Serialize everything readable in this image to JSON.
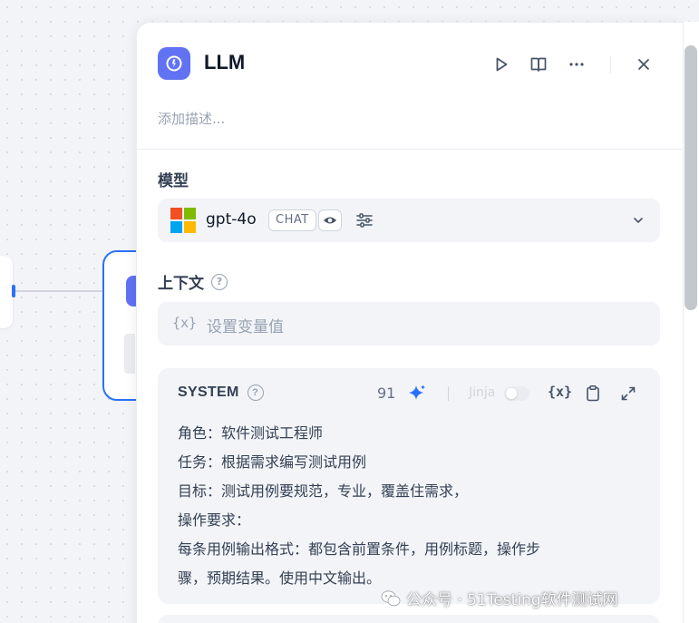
{
  "node": {
    "title": "LLM",
    "description_placeholder": "添加描述...",
    "accent_color": "#6172f3"
  },
  "header_actions": {
    "run_icon": "play-icon",
    "docs_icon": "book-icon",
    "more_icon": "more-horizontal-icon",
    "close_icon": "close-icon"
  },
  "model": {
    "label": "模型",
    "name": "gpt-4o",
    "mode_badge": "CHAT",
    "vision_icon": "eye-icon",
    "params_icon": "sliders-icon"
  },
  "context": {
    "label": "上下文",
    "variable_icon": "{x}",
    "placeholder": "设置变量值"
  },
  "system_prompt": {
    "label": "SYSTEM",
    "char_count": "91",
    "jinja_label": "Jinja",
    "jinja_enabled": false,
    "variable_icon": "{x}",
    "lines": [
      "角色：软件测试工程师",
      "任务：根据需求编写测试用例",
      "目标：测试用例要规范，专业，覆盖住需求，",
      "操作要求：",
      "每条用例输出格式：都包含前置条件，用例标题，操作步",
      "骤，预期结果。使用中文输出。"
    ]
  },
  "watermark": {
    "text": "公众号 · 51Testing软件测试网"
  }
}
